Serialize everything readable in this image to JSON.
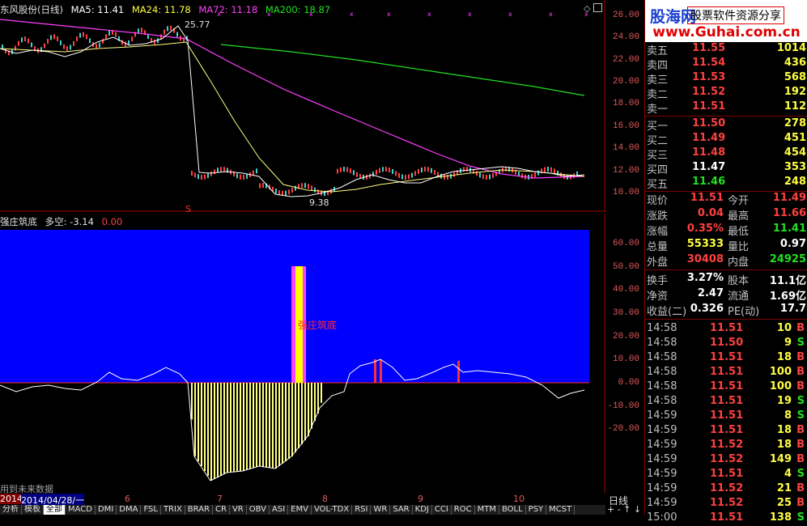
{
  "main_chart": {
    "title": "东风股份(日线)",
    "ma5": "MA5: 11.41",
    "ma24": "MA24: 11.78",
    "ma72": "MA72: 11.18",
    "ma200": "MA200: 18.87",
    "y_ticks": [
      "26.00",
      "24.00",
      "22.00",
      "20.00",
      "18.00",
      "16.00",
      "14.00",
      "12.00",
      "10.00"
    ],
    "high_label": "25.77",
    "low_label": "9.38",
    "colors": {
      "ma5": "#ffffff",
      "ma24": "#ffff00",
      "ma72": "#ff40ff",
      "ma200": "#20e020"
    }
  },
  "indicator": {
    "name": "强庄筑底",
    "duokong": "多空: -3.14",
    "value": "0.00",
    "label": "强庄筑底",
    "y_ticks": [
      "60.00",
      "50.00",
      "40.00",
      "30.00",
      "20.00",
      "10.00",
      "0.00",
      "-10.00",
      "-20.00"
    ]
  },
  "date_axis": {
    "note": "用到未来数据",
    "start_date": "2014/04/28/一",
    "year": "2014",
    "months": [
      "6",
      "7",
      "8",
      "9",
      "10"
    ],
    "period": "日线"
  },
  "bottom_tabs": [
    "分析",
    "模板",
    "全部",
    "MACD",
    "DMI",
    "DMA",
    "FSL",
    "TRIX",
    "BRAR",
    "CR",
    "VR",
    "OBV",
    "ASI",
    "EMV",
    "VOL-TDX",
    "RSI",
    "WR",
    "SAR",
    "KDJ",
    "CCI",
    "ROC",
    "MTM",
    "BOLL",
    "PSY",
    "MCST"
  ],
  "ad": {
    "logo": "股海网",
    "tagline": "股票软件资源分享",
    "url": "www.Guhai.com.cn"
  },
  "order_book": {
    "asks": [
      {
        "label": "卖五",
        "price": "11.55",
        "vol": "1014"
      },
      {
        "label": "卖四",
        "price": "11.54",
        "vol": "436"
      },
      {
        "label": "卖三",
        "price": "11.53",
        "vol": "568"
      },
      {
        "label": "卖二",
        "price": "11.52",
        "vol": "192"
      },
      {
        "label": "卖一",
        "price": "11.51",
        "vol": "112"
      }
    ],
    "bids": [
      {
        "label": "买一",
        "price": "11.50",
        "vol": "278"
      },
      {
        "label": "买二",
        "price": "11.49",
        "vol": "451"
      },
      {
        "label": "买三",
        "price": "11.48",
        "vol": "454"
      },
      {
        "label": "买四",
        "price": "11.47",
        "vol": "353"
      },
      {
        "label": "买五",
        "price": "11.46",
        "vol": "248"
      }
    ]
  },
  "quote": [
    {
      "l1": "现价",
      "v1": "11.51",
      "l2": "今开",
      "v2": "11.49"
    },
    {
      "l1": "涨跌",
      "v1": "0.04",
      "l2": "最高",
      "v2": "11.66"
    },
    {
      "l1": "涨幅",
      "v1": "0.35%",
      "l2": "最低",
      "v2": "11.41"
    },
    {
      "l1": "总量",
      "v1": "55333",
      "l2": "量比",
      "v2": "0.97"
    },
    {
      "l1": "外盘",
      "v1": "30408",
      "l2": "内盘",
      "v2": "24925"
    }
  ],
  "stats": [
    {
      "l1": "换手",
      "v1": "3.27%",
      "l2": "股本",
      "v2": "11.1亿"
    },
    {
      "l1": "净资",
      "v1": "2.47",
      "l2": "流通",
      "v2": "1.69亿"
    },
    {
      "l1": "收益(二)",
      "v1": "0.326",
      "l2": "PE(动)",
      "v2": "17.7"
    }
  ],
  "ticks": [
    {
      "time": "14:58",
      "price": "11.51",
      "vol": "10",
      "bs": "B"
    },
    {
      "time": "14:58",
      "price": "11.50",
      "vol": "9",
      "bs": "S"
    },
    {
      "time": "14:58",
      "price": "11.51",
      "vol": "18",
      "bs": "B"
    },
    {
      "time": "14:58",
      "price": "11.51",
      "vol": "100",
      "bs": "B"
    },
    {
      "time": "14:58",
      "price": "11.51",
      "vol": "100",
      "bs": "B"
    },
    {
      "time": "14:58",
      "price": "11.51",
      "vol": "19",
      "bs": "S"
    },
    {
      "time": "14:59",
      "price": "11.51",
      "vol": "8",
      "bs": "S"
    },
    {
      "time": "14:59",
      "price": "11.51",
      "vol": "18",
      "bs": "B"
    },
    {
      "time": "14:59",
      "price": "11.52",
      "vol": "18",
      "bs": "B"
    },
    {
      "time": "14:59",
      "price": "11.52",
      "vol": "149",
      "bs": "B"
    },
    {
      "time": "14:59",
      "price": "11.51",
      "vol": "4",
      "bs": "S"
    },
    {
      "time": "14:59",
      "price": "11.52",
      "vol": "21",
      "bs": "B"
    },
    {
      "time": "14:59",
      "price": "11.52",
      "vol": "25",
      "bs": "B"
    },
    {
      "time": "15:00",
      "price": "11.51",
      "vol": "138",
      "bs": "S"
    }
  ]
}
